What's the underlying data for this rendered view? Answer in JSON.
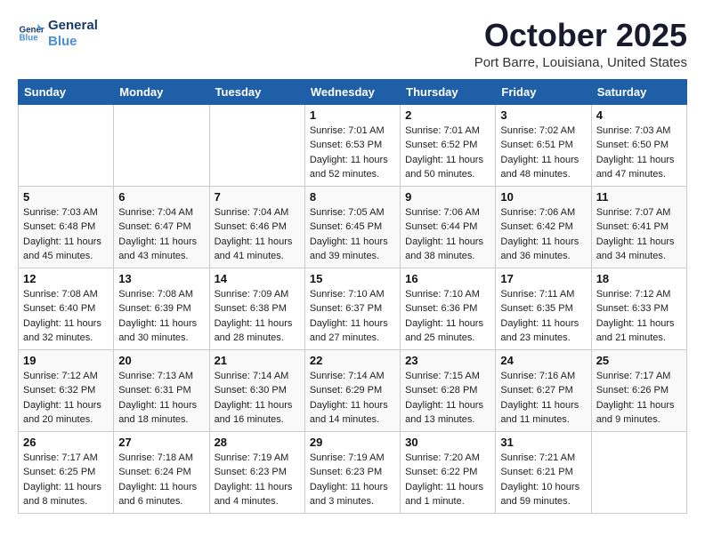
{
  "header": {
    "logo_line1": "General",
    "logo_line2": "Blue",
    "month": "October 2025",
    "location": "Port Barre, Louisiana, United States"
  },
  "weekdays": [
    "Sunday",
    "Monday",
    "Tuesday",
    "Wednesday",
    "Thursday",
    "Friday",
    "Saturday"
  ],
  "weeks": [
    [
      {
        "day": "",
        "info": ""
      },
      {
        "day": "",
        "info": ""
      },
      {
        "day": "",
        "info": ""
      },
      {
        "day": "1",
        "info": "Sunrise: 7:01 AM\nSunset: 6:53 PM\nDaylight: 11 hours\nand 52 minutes."
      },
      {
        "day": "2",
        "info": "Sunrise: 7:01 AM\nSunset: 6:52 PM\nDaylight: 11 hours\nand 50 minutes."
      },
      {
        "day": "3",
        "info": "Sunrise: 7:02 AM\nSunset: 6:51 PM\nDaylight: 11 hours\nand 48 minutes."
      },
      {
        "day": "4",
        "info": "Sunrise: 7:03 AM\nSunset: 6:50 PM\nDaylight: 11 hours\nand 47 minutes."
      }
    ],
    [
      {
        "day": "5",
        "info": "Sunrise: 7:03 AM\nSunset: 6:48 PM\nDaylight: 11 hours\nand 45 minutes."
      },
      {
        "day": "6",
        "info": "Sunrise: 7:04 AM\nSunset: 6:47 PM\nDaylight: 11 hours\nand 43 minutes."
      },
      {
        "day": "7",
        "info": "Sunrise: 7:04 AM\nSunset: 6:46 PM\nDaylight: 11 hours\nand 41 minutes."
      },
      {
        "day": "8",
        "info": "Sunrise: 7:05 AM\nSunset: 6:45 PM\nDaylight: 11 hours\nand 39 minutes."
      },
      {
        "day": "9",
        "info": "Sunrise: 7:06 AM\nSunset: 6:44 PM\nDaylight: 11 hours\nand 38 minutes."
      },
      {
        "day": "10",
        "info": "Sunrise: 7:06 AM\nSunset: 6:42 PM\nDaylight: 11 hours\nand 36 minutes."
      },
      {
        "day": "11",
        "info": "Sunrise: 7:07 AM\nSunset: 6:41 PM\nDaylight: 11 hours\nand 34 minutes."
      }
    ],
    [
      {
        "day": "12",
        "info": "Sunrise: 7:08 AM\nSunset: 6:40 PM\nDaylight: 11 hours\nand 32 minutes."
      },
      {
        "day": "13",
        "info": "Sunrise: 7:08 AM\nSunset: 6:39 PM\nDaylight: 11 hours\nand 30 minutes."
      },
      {
        "day": "14",
        "info": "Sunrise: 7:09 AM\nSunset: 6:38 PM\nDaylight: 11 hours\nand 28 minutes."
      },
      {
        "day": "15",
        "info": "Sunrise: 7:10 AM\nSunset: 6:37 PM\nDaylight: 11 hours\nand 27 minutes."
      },
      {
        "day": "16",
        "info": "Sunrise: 7:10 AM\nSunset: 6:36 PM\nDaylight: 11 hours\nand 25 minutes."
      },
      {
        "day": "17",
        "info": "Sunrise: 7:11 AM\nSunset: 6:35 PM\nDaylight: 11 hours\nand 23 minutes."
      },
      {
        "day": "18",
        "info": "Sunrise: 7:12 AM\nSunset: 6:33 PM\nDaylight: 11 hours\nand 21 minutes."
      }
    ],
    [
      {
        "day": "19",
        "info": "Sunrise: 7:12 AM\nSunset: 6:32 PM\nDaylight: 11 hours\nand 20 minutes."
      },
      {
        "day": "20",
        "info": "Sunrise: 7:13 AM\nSunset: 6:31 PM\nDaylight: 11 hours\nand 18 minutes."
      },
      {
        "day": "21",
        "info": "Sunrise: 7:14 AM\nSunset: 6:30 PM\nDaylight: 11 hours\nand 16 minutes."
      },
      {
        "day": "22",
        "info": "Sunrise: 7:14 AM\nSunset: 6:29 PM\nDaylight: 11 hours\nand 14 minutes."
      },
      {
        "day": "23",
        "info": "Sunrise: 7:15 AM\nSunset: 6:28 PM\nDaylight: 11 hours\nand 13 minutes."
      },
      {
        "day": "24",
        "info": "Sunrise: 7:16 AM\nSunset: 6:27 PM\nDaylight: 11 hours\nand 11 minutes."
      },
      {
        "day": "25",
        "info": "Sunrise: 7:17 AM\nSunset: 6:26 PM\nDaylight: 11 hours\nand 9 minutes."
      }
    ],
    [
      {
        "day": "26",
        "info": "Sunrise: 7:17 AM\nSunset: 6:25 PM\nDaylight: 11 hours\nand 8 minutes."
      },
      {
        "day": "27",
        "info": "Sunrise: 7:18 AM\nSunset: 6:24 PM\nDaylight: 11 hours\nand 6 minutes."
      },
      {
        "day": "28",
        "info": "Sunrise: 7:19 AM\nSunset: 6:23 PM\nDaylight: 11 hours\nand 4 minutes."
      },
      {
        "day": "29",
        "info": "Sunrise: 7:19 AM\nSunset: 6:23 PM\nDaylight: 11 hours\nand 3 minutes."
      },
      {
        "day": "30",
        "info": "Sunrise: 7:20 AM\nSunset: 6:22 PM\nDaylight: 11 hours\nand 1 minute."
      },
      {
        "day": "31",
        "info": "Sunrise: 7:21 AM\nSunset: 6:21 PM\nDaylight: 10 hours\nand 59 minutes."
      },
      {
        "day": "",
        "info": ""
      }
    ]
  ]
}
